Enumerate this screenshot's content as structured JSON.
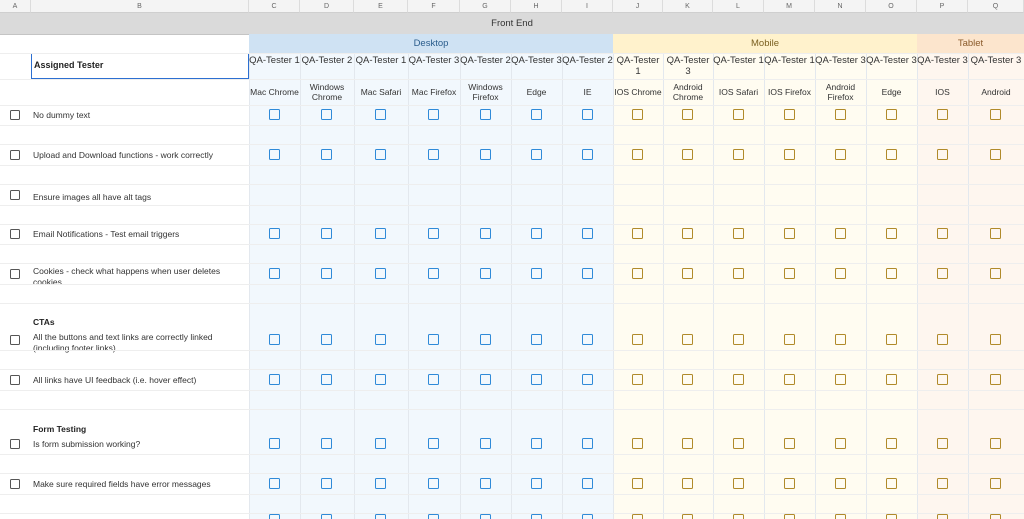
{
  "columns": [
    "A",
    "B",
    "C",
    "D",
    "E",
    "F",
    "G",
    "H",
    "I",
    "J",
    "K",
    "L",
    "M",
    "N",
    "O",
    "P",
    "Q"
  ],
  "banner": "Front End",
  "groups": [
    {
      "label": "Desktop",
      "kind": "desktop",
      "start": 2,
      "end": 8
    },
    {
      "label": "Mobile",
      "kind": "mobile",
      "start": 9,
      "end": 14
    },
    {
      "label": "Tablet",
      "kind": "tablet",
      "start": 15,
      "end": 16
    }
  ],
  "assigned_label": "Assigned Tester",
  "testers": [
    {
      "tester": "QA-Tester 1",
      "browser": "Mac Chrome",
      "kind": "desktop"
    },
    {
      "tester": "QA-Tester 2",
      "browser": "Windows Chrome",
      "kind": "desktop"
    },
    {
      "tester": "QA-Tester 1",
      "browser": "Mac Safari",
      "kind": "desktop"
    },
    {
      "tester": "QA-Tester 3",
      "browser": "Mac Firefox",
      "kind": "desktop"
    },
    {
      "tester": "QA-Tester 2",
      "browser": "Windows Firefox",
      "kind": "desktop"
    },
    {
      "tester": "QA-Tester 3",
      "browser": "Edge",
      "kind": "desktop"
    },
    {
      "tester": "QA-Tester 2",
      "browser": "IE",
      "kind": "desktop"
    },
    {
      "tester": "QA-Tester 1",
      "browser": "IOS Chrome",
      "kind": "mobile"
    },
    {
      "tester": "QA-Tester 3",
      "browser": "Android Chrome",
      "kind": "mobile"
    },
    {
      "tester": "QA-Tester 1",
      "browser": "IOS Safari",
      "kind": "mobile"
    },
    {
      "tester": "QA-Tester 1",
      "browser": "IOS Firefox",
      "kind": "mobile"
    },
    {
      "tester": "QA-Tester 3",
      "browser": "Android Firefox",
      "kind": "mobile"
    },
    {
      "tester": "QA-Tester 3",
      "browser": "Edge",
      "kind": "mobile"
    },
    {
      "tester": "QA-Tester 3",
      "browser": "IOS",
      "kind": "tablet"
    },
    {
      "tester": "QA-Tester 3",
      "browser": "Android",
      "kind": "tablet"
    }
  ],
  "rows": [
    {
      "type": "test",
      "label": "No dummy text"
    },
    {
      "type": "test",
      "label": "Upload and Download functions - work correctly"
    },
    {
      "type": "test",
      "label": "Ensure images all have alt tags",
      "label_low": true,
      "no_boxes": true
    },
    {
      "type": "test",
      "label": "Email Notifications - Test email triggers"
    },
    {
      "type": "test",
      "label": "Cookies - check what happens when user deletes cookies"
    },
    {
      "type": "section",
      "label": "CTAs"
    },
    {
      "type": "test",
      "label": "All the buttons and text links are correctly linked (including footer links)"
    },
    {
      "type": "test",
      "label": "All links have UI feedback (i.e. hover effect)"
    },
    {
      "type": "section",
      "label": "Form Testing"
    },
    {
      "type": "test",
      "label": "Is form submission working?"
    },
    {
      "type": "test",
      "label": "Make sure required fields have error messages"
    }
  ],
  "colors": {
    "desktop_box": "#2f8ad8",
    "mobile_box": "#b08a2a"
  }
}
